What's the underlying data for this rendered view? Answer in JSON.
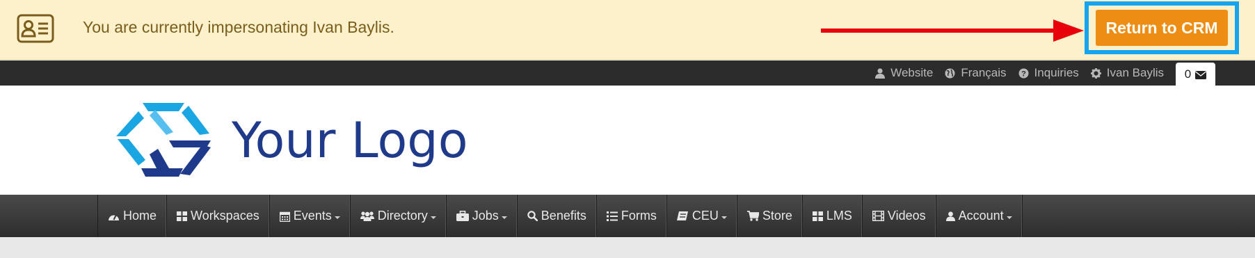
{
  "banner": {
    "message": "You are currently impersonating Ivan Baylis.",
    "return_button_label": "Return to CRM",
    "icon": "id-card-icon"
  },
  "topbar": {
    "links": [
      {
        "label": "Website",
        "icon": "user-icon"
      },
      {
        "label": "Français",
        "icon": "globe-icon"
      },
      {
        "label": "Inquiries",
        "icon": "question-circle-icon"
      },
      {
        "label": "Ivan Baylis",
        "icon": "gear-icon"
      }
    ],
    "message_count": "0"
  },
  "logo": {
    "text": "Your Logo"
  },
  "nav": {
    "items": [
      {
        "label": "Home",
        "icon": "dashboard-icon",
        "dropdown": false
      },
      {
        "label": "Workspaces",
        "icon": "grid-icon",
        "dropdown": false
      },
      {
        "label": "Events",
        "icon": "calendar-icon",
        "dropdown": true
      },
      {
        "label": "Directory",
        "icon": "users-icon",
        "dropdown": true
      },
      {
        "label": "Jobs",
        "icon": "briefcase-icon",
        "dropdown": true
      },
      {
        "label": "Benefits",
        "icon": "search-icon",
        "dropdown": false
      },
      {
        "label": "Forms",
        "icon": "list-icon",
        "dropdown": false
      },
      {
        "label": "CEU",
        "icon": "book-icon",
        "dropdown": true
      },
      {
        "label": "Store",
        "icon": "cart-icon",
        "dropdown": false
      },
      {
        "label": "LMS",
        "icon": "grid-icon",
        "dropdown": false
      },
      {
        "label": "Videos",
        "icon": "film-icon",
        "dropdown": false
      },
      {
        "label": "Account",
        "icon": "user-icon",
        "dropdown": true
      }
    ]
  },
  "colors": {
    "banner_bg": "#fdf1cc",
    "banner_text": "#7a5d1c",
    "crm_button": "#ee8d14",
    "highlight_frame": "#14a3ec",
    "arrow": "#e8000b",
    "topbar_bg": "#2c2c2c",
    "logo_text": "#1f3a8a"
  }
}
